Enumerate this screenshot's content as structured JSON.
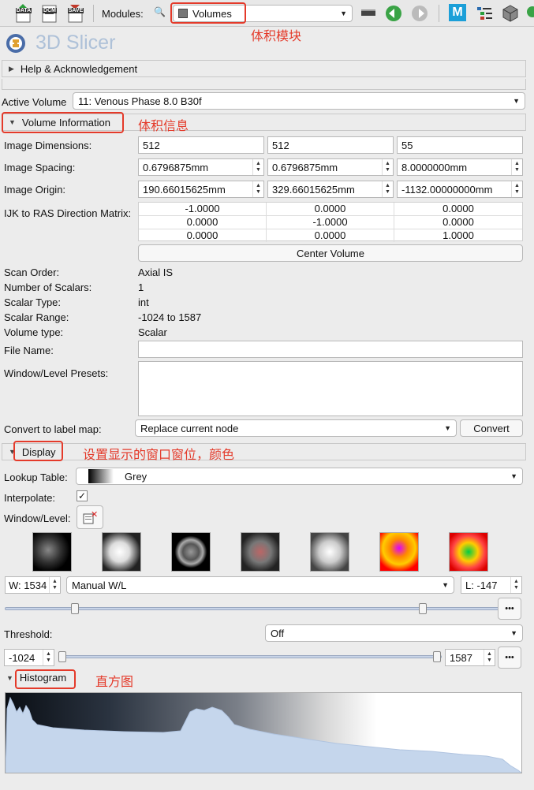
{
  "toolbar": {
    "data_label": "DATA",
    "dcm_label": "DCM",
    "save_label": "SAVE",
    "modules_label": "Modules:",
    "module_selected": "Volumes",
    "m_label": "M"
  },
  "app": {
    "title": "3D Slicer"
  },
  "help_section": {
    "label": "Help & Acknowledgement"
  },
  "active_volume": {
    "label": "Active Volume",
    "value": "11: Venous Phase  8.0  B30f"
  },
  "volume_info": {
    "label": "Volume Information",
    "dimensions_label": "Image Dimensions:",
    "dimensions": [
      "512",
      "512",
      "55"
    ],
    "spacing_label": "Image Spacing:",
    "spacing": [
      "0.6796875mm",
      "0.6796875mm",
      "8.0000000mm"
    ],
    "origin_label": "Image Origin:",
    "origin": [
      "190.66015625mm",
      "329.66015625mm",
      "-1132.00000000mm"
    ],
    "matrix_label": "IJK to RAS Direction Matrix:",
    "matrix": [
      [
        "-1.0000",
        "0.0000",
        "0.0000"
      ],
      [
        "0.0000",
        "-1.0000",
        "0.0000"
      ],
      [
        "0.0000",
        "0.0000",
        "1.0000"
      ]
    ],
    "center_button": "Center Volume",
    "scan_order_label": "Scan Order:",
    "scan_order": "Axial IS",
    "num_scalars_label": "Number of Scalars:",
    "num_scalars": "1",
    "scalar_type_label": "Scalar Type:",
    "scalar_type": "int",
    "scalar_range_label": "Scalar Range:",
    "scalar_range": "-1024 to 1587",
    "volume_type_label": "Volume type:",
    "volume_type": "Scalar",
    "file_name_label": "File Name:",
    "file_name": "",
    "wl_presets_label": "Window/Level Presets:",
    "convert_label": "Convert to label map:",
    "convert_option": "Replace current node",
    "convert_button": "Convert"
  },
  "display": {
    "label": "Display",
    "lookup_label": "Lookup Table:",
    "lookup_value": "Grey",
    "interpolate_label": "Interpolate:",
    "interpolate_check": "✓",
    "window_level_label": "Window/Level:",
    "window_value": "W: 1534",
    "wl_mode": "Manual W/L",
    "level_value": "L: -147",
    "threshold_label": "Threshold:",
    "threshold_mode": "Off",
    "threshold_min": "-1024",
    "threshold_max": "1587",
    "dots": "•••"
  },
  "histogram": {
    "label": "Histogram"
  },
  "annotations": {
    "volumes_module": "体积模块",
    "volume_info": "体积信息",
    "display": "设置显示的窗口窗位，颜色",
    "histogram": "直方图"
  },
  "colors": {
    "annotation": "#e43a2a",
    "accent": "#3a6fb7"
  }
}
